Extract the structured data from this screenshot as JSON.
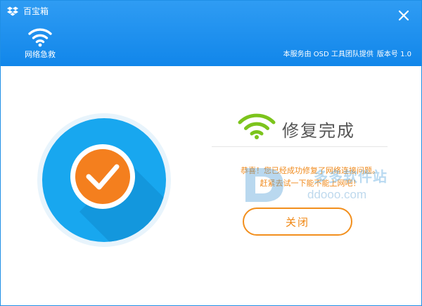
{
  "window": {
    "title": "百宝箱"
  },
  "header": {
    "feature_label": "网络急救",
    "provider_text": "本服务由 OSD 工具团队提供",
    "version": "版本号 1.0"
  },
  "result": {
    "title": "修复完成",
    "message_line1": "恭喜！您已经成功修复了网络连接问题。",
    "message_line2": "赶紧去试一下能不能上网吧！",
    "close_label": "关闭"
  },
  "watermark": {
    "text_cn": "多多软件站",
    "url": "ddooo.com"
  },
  "icons": {
    "app_logo": "dropbox-box-icon",
    "close": "close-icon",
    "header_wifi": "wifi-icon",
    "result_wifi": "wifi-icon",
    "success": "check-circle-icon"
  },
  "colors": {
    "header_blue": "#1a8ff0",
    "circle_blue": "#18a7ef",
    "check_orange": "#f47f1e",
    "wifi_green": "#7cc41c",
    "message_orange": "#f08a1c",
    "button_orange": "#f28f1d"
  }
}
